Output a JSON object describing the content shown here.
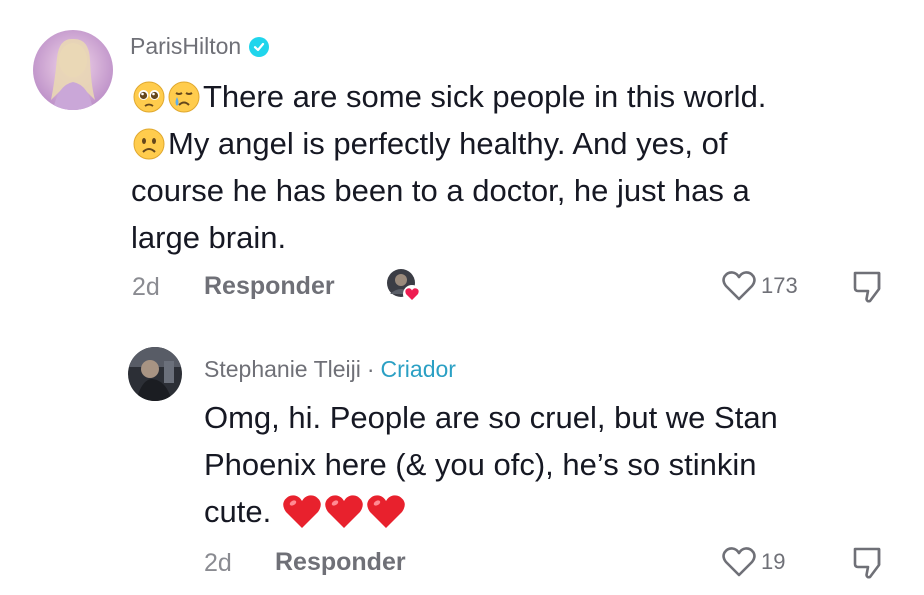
{
  "comments": [
    {
      "username": "ParisHilton",
      "verified": true,
      "text_line1": "There are some sick people in this world.",
      "text_line2": "My angel is perfectly healthy. And yes, of",
      "text_line3": "course he has been to a doctor, he just has a",
      "text_line4": "large brain.",
      "time": "2d",
      "reply_label": "Responder",
      "likes": "173",
      "emojis": [
        "pleading-face",
        "crying-face",
        "frowning-face"
      ],
      "liked_by_creator": true
    }
  ],
  "replies": [
    {
      "username": "Stephanie Tleiji",
      "separator": "·",
      "badge": "Criador",
      "text_line1": "Omg, hi. People are so cruel, but we Stan",
      "text_line2": "Phoenix here (& you ofc), he’s so stinkin",
      "text_line3": "cute.",
      "time": "2d",
      "reply_label": "Responder",
      "likes": "19",
      "emojis": [
        "red-heart",
        "red-heart",
        "red-heart"
      ]
    }
  ],
  "colors": {
    "verified": "#20d5ec",
    "creator_badge": "#2ba0c4",
    "heart_red": "#ee1d52"
  }
}
